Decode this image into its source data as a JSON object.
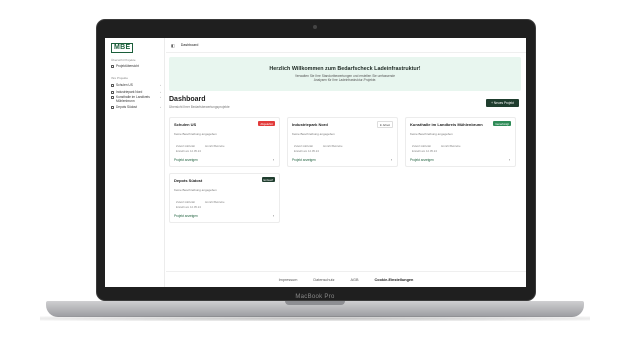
{
  "device": {
    "label": "MacBook Pro"
  },
  "sidebar": {
    "logo": "MBE",
    "section_overview": "Übersicht Projekte",
    "overview_item": "Projektübersicht",
    "section_projects": "Ihre Projekte",
    "items": [
      {
        "label": "Schulen US"
      },
      {
        "label": "Industriepark Nord"
      },
      {
        "label": "Kunsthalle im Landkreis Mühlenbrunn"
      },
      {
        "label": "Depots Südost"
      }
    ]
  },
  "topbar": {
    "toggle_icon": "sidebar-toggle-icon",
    "crumb": "Dashboard"
  },
  "hero": {
    "title": "Herzlich Willkommen zum Bedarfscheck Ladeinfrastruktur!",
    "subtitle": "Verwalten Sie Ihre Standortbewertungen und erstellen Sie umfassende Analysen für Ihre Ladeinfrastruktur-Projekte."
  },
  "dashboard": {
    "title": "Dashboard",
    "subtitle": "Übersicht Ihrer Bedarfsbewertungsprojekte",
    "new_button": "+ Neues Projekt"
  },
  "cards": [
    {
      "title": "Schulen US",
      "badge": "Abgelehnt",
      "badge_kind": "red",
      "description": "Keine Beschreibung angegeben",
      "meta_a": "Zuletzt Aktivität",
      "meta_b": "Anzahl Betriebe",
      "date": "Erstellt am 12.05.24",
      "link": "Projekt anzeigen"
    },
    {
      "title": "Industriepark Nord",
      "badge": "In Arbeit",
      "badge_kind": "gray",
      "description": "Keine Beschreibung angegeben",
      "meta_a": "Zuletzt Aktivität",
      "meta_b": "Anzahl Betriebe",
      "date": "Erstellt am 12.05.24",
      "link": "Projekt anzeigen"
    },
    {
      "title": "Kunsthalle im Landkreis Mühlenbrunn",
      "badge": "Genehmigt",
      "badge_kind": "green",
      "description": "Keine Beschreibung angegeben",
      "meta_a": "Zuletzt Aktivität",
      "meta_b": "Anzahl Betriebe",
      "date": "Erstellt am 12.05.24",
      "link": "Projekt anzeigen"
    },
    {
      "title": "Depots Südost",
      "badge": "Entwurf",
      "badge_kind": "dark",
      "description": "Keine Beschreibung angegeben",
      "meta_a": "Zuletzt Aktivität",
      "meta_b": "Anzahl Betriebe",
      "date": "Erstellt am 12.05.24",
      "link": "Projekt anzeigen"
    }
  ],
  "footer": {
    "links": [
      "Impressum",
      "Datenschutz",
      "AGB",
      "Cookie-Einstellungen"
    ]
  }
}
